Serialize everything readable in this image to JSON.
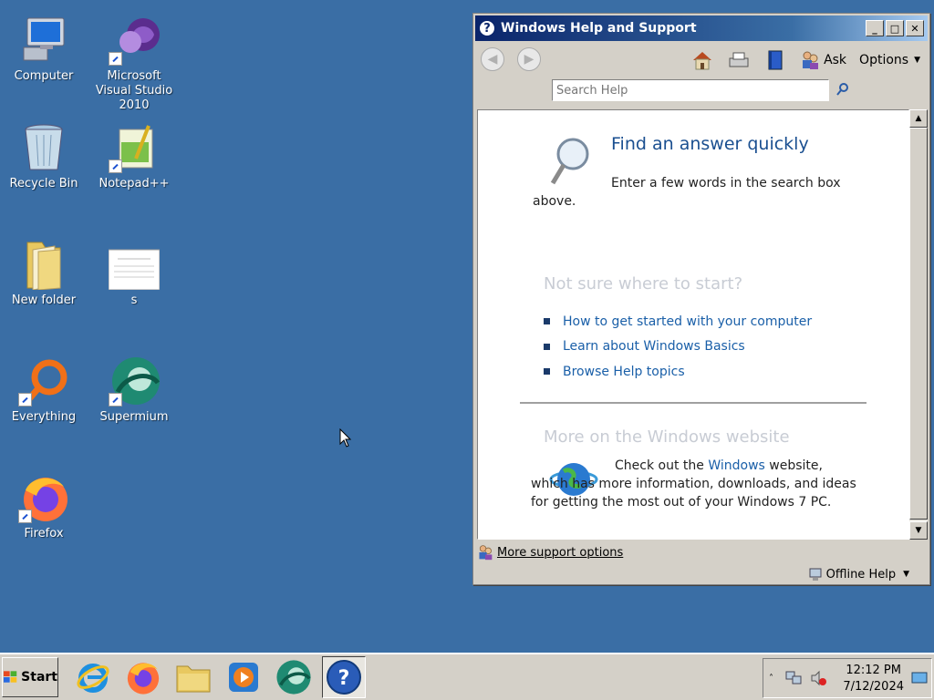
{
  "desktop": {
    "icons": [
      {
        "label": "Computer"
      },
      {
        "label": "Microsoft Visual Studio 2010"
      },
      {
        "label": "Recycle Bin"
      },
      {
        "label": "Notepad++"
      },
      {
        "label": "New folder"
      },
      {
        "label": "s"
      },
      {
        "label": "Everything"
      },
      {
        "label": "Supermium"
      },
      {
        "label": "Firefox"
      }
    ]
  },
  "help": {
    "title": "Windows Help and Support",
    "toolbar": {
      "ask": "Ask",
      "options": "Options"
    },
    "search_placeholder": "Search Help",
    "find_title": "Find an answer quickly",
    "find_desc": "Enter a few words in the search box above.",
    "not_sure": "Not sure where to start?",
    "links": [
      "How to get started with your computer",
      "Learn about Windows Basics",
      "Browse Help topics"
    ],
    "more_heading": "More on the Windows website",
    "web_pre": "Check out the ",
    "web_link": "Windows",
    "web_post": " website, which has more information, downloads, and ideas for getting the most out of your Windows 7 PC.",
    "more_support": "More support options",
    "offline": "Offline Help"
  },
  "taskbar": {
    "start": "Start",
    "time": "12:12 PM",
    "date": "7/12/2024"
  }
}
